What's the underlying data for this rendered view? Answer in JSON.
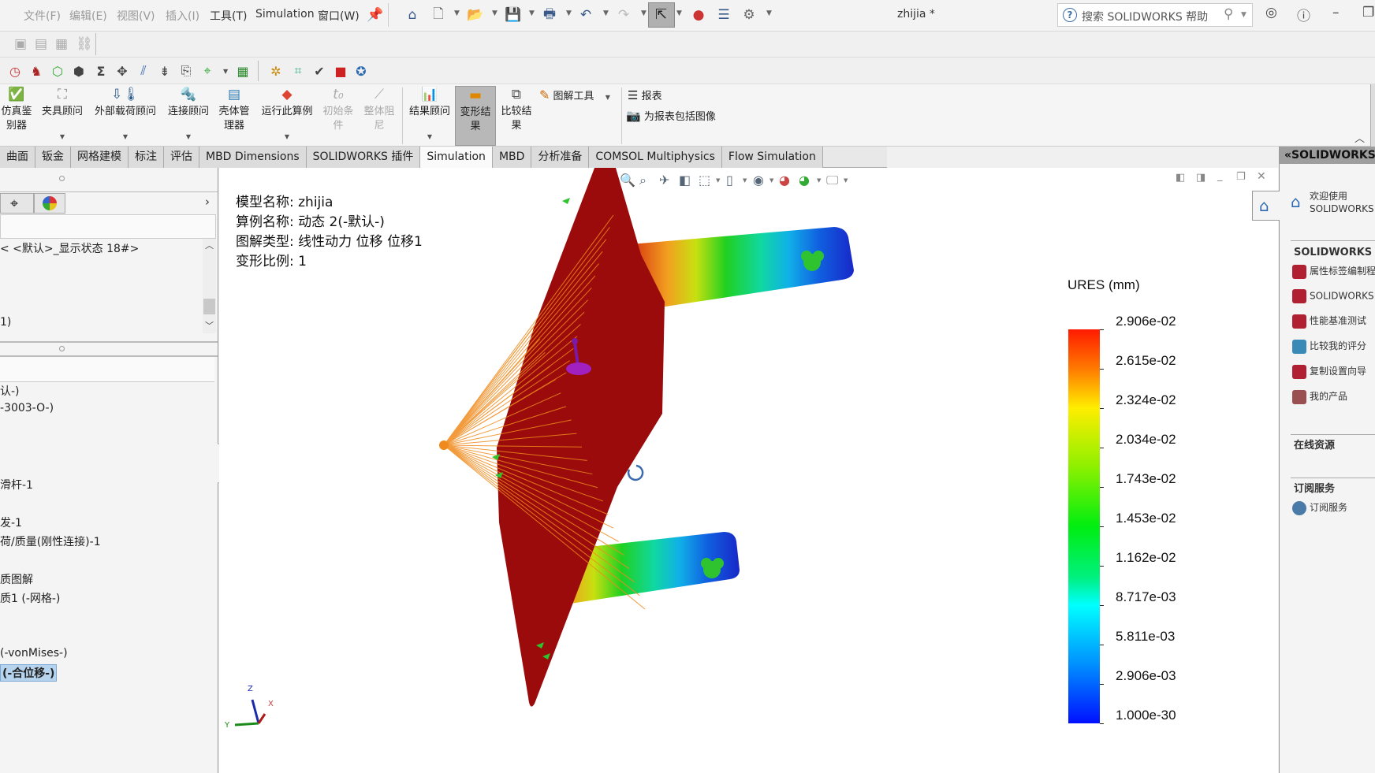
{
  "titlebar": {
    "menus": [
      "文件(F)",
      "编辑(E)",
      "视图(V)",
      "插入(I)",
      "工具(T)",
      "Simulation",
      "窗口(W)"
    ],
    "document_title": "zhijia *",
    "help_search_placeholder": "搜索 SOLIDWORKS 帮助",
    "icons": [
      "pin-icon",
      "home-icon",
      "new-document-icon",
      "open-icon",
      "save-icon",
      "print-icon",
      "undo-icon",
      "redo-icon",
      "select-icon",
      "rebuild-icon",
      "file-properties-icon",
      "options-icon"
    ]
  },
  "command_manager": {
    "buttons": [
      {
        "label": "仿真鉴别器",
        "icon": "simulation-evaluator-icon",
        "enabled": true
      },
      {
        "label": "夹具顾问",
        "icon": "fixture-advisor-icon",
        "enabled": true
      },
      {
        "label": "外部载荷顾问",
        "icon": "external-load-advisor-icon",
        "enabled": true
      },
      {
        "label": "连接顾问",
        "icon": "connection-advisor-icon",
        "enabled": true
      },
      {
        "label": "壳体管理器",
        "icon": "shell-manager-icon",
        "enabled": true
      },
      {
        "label": "运行此算例",
        "icon": "run-study-icon",
        "enabled": true
      },
      {
        "label": "初始条件",
        "icon": "initial-conditions-icon",
        "enabled": false
      },
      {
        "label": "整体阻尼",
        "icon": "global-damping-icon",
        "enabled": false
      },
      {
        "label": "结果顾问",
        "icon": "results-advisor-icon",
        "enabled": true
      },
      {
        "label": "变形结果",
        "icon": "deformed-result-icon",
        "enabled": true,
        "active": true
      },
      {
        "label": "比较结果",
        "icon": "compare-results-icon",
        "enabled": true
      }
    ],
    "plot_tools_label": "图解工具",
    "report_label": "报表",
    "include_image_label": "为报表包括图像"
  },
  "tabs": [
    {
      "label": "曲面",
      "active": false
    },
    {
      "label": "钣金",
      "active": false
    },
    {
      "label": "网格建模",
      "active": false
    },
    {
      "label": "标注",
      "active": false
    },
    {
      "label": "评估",
      "active": false
    },
    {
      "label": "MBD Dimensions",
      "active": false
    },
    {
      "label": "SOLIDWORKS 插件",
      "active": false
    },
    {
      "label": "Simulation",
      "active": true
    },
    {
      "label": "MBD",
      "active": false
    },
    {
      "label": "分析准备",
      "active": false
    },
    {
      "label": "COMSOL Multiphysics",
      "active": false
    },
    {
      "label": "Flow Simulation",
      "active": false
    }
  ],
  "left_panel": {
    "display_state": "< <默认>_显示状态 18#>",
    "upper_item": "1)",
    "tree_items": [
      {
        "text": "认-)",
        "selected": false
      },
      {
        "text": "-3003-O-)",
        "selected": false
      },
      {
        "text": "滑杆-1",
        "selected": false
      },
      {
        "text": "发-1",
        "selected": false
      },
      {
        "text": "荷/质量(刚性连接)-1",
        "selected": false
      },
      {
        "text": "质图解",
        "selected": false
      },
      {
        "text": "质1 (-网格-)",
        "selected": false
      },
      {
        "text": "(-vonMises-)",
        "selected": false
      },
      {
        "text": "(-合位移-)",
        "selected": true
      }
    ]
  },
  "viewport": {
    "info": {
      "model_name": "模型名称: zhijia",
      "study_name": "算例名称: 动态 2(-默认-)",
      "plot_type": "图解类型: 线性动力 位移 位移1",
      "deformation_scale": "变形比例: 1"
    },
    "triad": {
      "x": "X",
      "y": "Y",
      "z": "Z"
    },
    "legend": {
      "title": "URES (mm)",
      "labels": [
        "2.906e-02",
        "2.615e-02",
        "2.324e-02",
        "2.034e-02",
        "1.743e-02",
        "1.453e-02",
        "1.162e-02",
        "8.717e-03",
        "5.811e-03",
        "2.906e-03",
        "1.000e-30"
      ],
      "max": 0.02906,
      "min": 1e-30
    },
    "colors": {
      "part_red": "#9b0b0b",
      "connector_orange": "#f08a1c"
    }
  },
  "task_pane": {
    "header": "«SOLIDWORKS",
    "welcome_line1": "欢迎使用",
    "welcome_line2": "SOLIDWORKS",
    "tools_section": "SOLIDWORKS 工",
    "tools": [
      "属性标签编制程",
      "SOLIDWORKS",
      "性能基准测试",
      "比较我的评分",
      "复制设置向导",
      "我的产品"
    ],
    "online_section": "在线资源",
    "subscription_section": "订阅服务",
    "subscription_item": "订阅服务"
  }
}
